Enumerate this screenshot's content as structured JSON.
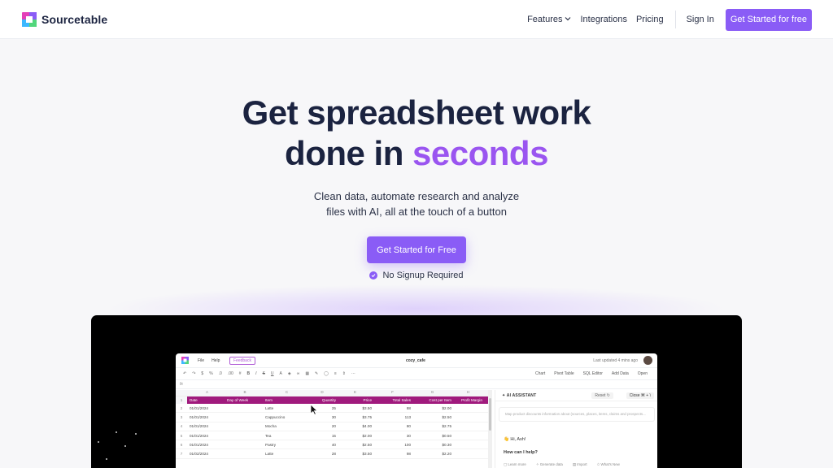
{
  "nav": {
    "brand": "Sourcetable",
    "links": [
      "Features",
      "Integrations",
      "Pricing"
    ],
    "sign_in": "Sign In",
    "cta": "Get Started for free"
  },
  "hero": {
    "title_line1": "Get spreadsheet work",
    "title_line2_plain": "done in ",
    "title_line2_accent": "seconds",
    "subtitle_line1": "Clean data, automate research and analyze",
    "subtitle_line2": "files with AI, all at the touch of a button",
    "cta": "Get Started for Free",
    "note": "No Signup Required"
  },
  "app": {
    "menu": [
      "File",
      "Help"
    ],
    "feedback": "Feedback",
    "filename": "cozy_cafe",
    "updated": "Last updated 4 mins ago",
    "toolbar_right": [
      "Chart",
      "Pivot Table",
      "SQL Editor",
      "Add Data",
      "Open"
    ],
    "formula_label": "fx",
    "col_letters": [
      "A",
      "B",
      "C",
      "D",
      "E",
      "F",
      "G",
      "H"
    ],
    "headers": [
      "Date",
      "Day of Week",
      "Item",
      "Quantity",
      "Price",
      "Total Sales",
      "Cost per Item",
      "Profit Margin"
    ],
    "rows": [
      {
        "n": "2",
        "cells": [
          "01/01/2024",
          "",
          "Latte",
          "25",
          "$3.50",
          "88",
          "$2.00",
          ""
        ]
      },
      {
        "n": "3",
        "cells": [
          "01/01/2024",
          "",
          "Cappuccino",
          "30",
          "$3.75",
          "113",
          "$2.50",
          ""
        ]
      },
      {
        "n": "4",
        "cells": [
          "01/01/2024",
          "",
          "Mocha",
          "20",
          "$4.00",
          "80",
          "$2.75",
          ""
        ]
      },
      {
        "n": "5",
        "cells": [
          "01/01/2024",
          "",
          "Tea",
          "15",
          "$2.00",
          "30",
          "$0.50",
          ""
        ]
      },
      {
        "n": "6",
        "cells": [
          "01/01/2024",
          "",
          "Pastry",
          "40",
          "$2.50",
          "100",
          "$0.30",
          ""
        ]
      },
      {
        "n": "7",
        "cells": [
          "01/02/2024",
          "",
          "Latte",
          "28",
          "$3.50",
          "98",
          "$2.20",
          ""
        ]
      }
    ],
    "ai": {
      "title": "AI ASSISTANT",
      "reset": "Reset",
      "close": "Close",
      "close_shortcut": "⌘ + \\",
      "placeholder": "Map product discounts information about (sources, places, items, claims and prospects...",
      "greeting": "Hi, Ash!",
      "help": "How can I help?",
      "chips": [
        "Learn more",
        "Generate data",
        "Import",
        "What's New"
      ]
    }
  },
  "colors": {
    "brand": "#8a5cf6",
    "accent_text": "#9a55f0",
    "header_row": "#a01a7d"
  }
}
